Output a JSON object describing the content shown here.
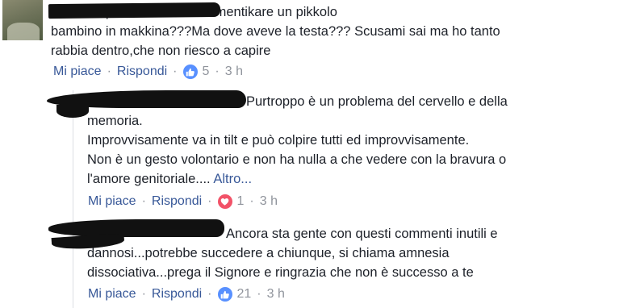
{
  "comments": [
    {
      "text": "Io non capisco come si fa dimentikare un pikkolo\nbambino in makkina???Ma dove aveve la testa??? Scusami sai ma ho tanto\nrabbia dentro,che non riesco a capire",
      "like_label": "Mi piace",
      "reply_label": "Rispondi",
      "reaction_icon": "like-icon",
      "reaction_count": "5",
      "time": "3 h"
    },
    {
      "text": "Purtroppo è un problema del cervello e della\nmemoria.\nImprovvisamente va in tilt e può colpire tutti ed improvvisamente.\nNon è un gesto volontario e non ha nulla a che vedere con la bravura o\nl'amore genitoriale....",
      "more_label": "Altro...",
      "like_label": "Mi piace",
      "reply_label": "Rispondi",
      "reaction_icon": "heart-icon",
      "reaction_count": "1",
      "time": "3 h"
    },
    {
      "text": "Ancora sta gente con questi commenti inutili e\ndannosi...potrebbe succedere a chiunque, si chiama amnesia\ndissociativa...prega il Signore e ringrazia che non è successo a te",
      "like_label": "Mi piace",
      "reply_label": "Rispondi",
      "reaction_icon": "like-icon",
      "reaction_count": "21",
      "time": "3 h"
    }
  ],
  "colors": {
    "link": "#385898",
    "meta_gray": "#90949c",
    "like_badge": "#5890ff",
    "love_badge": "#f25268"
  }
}
